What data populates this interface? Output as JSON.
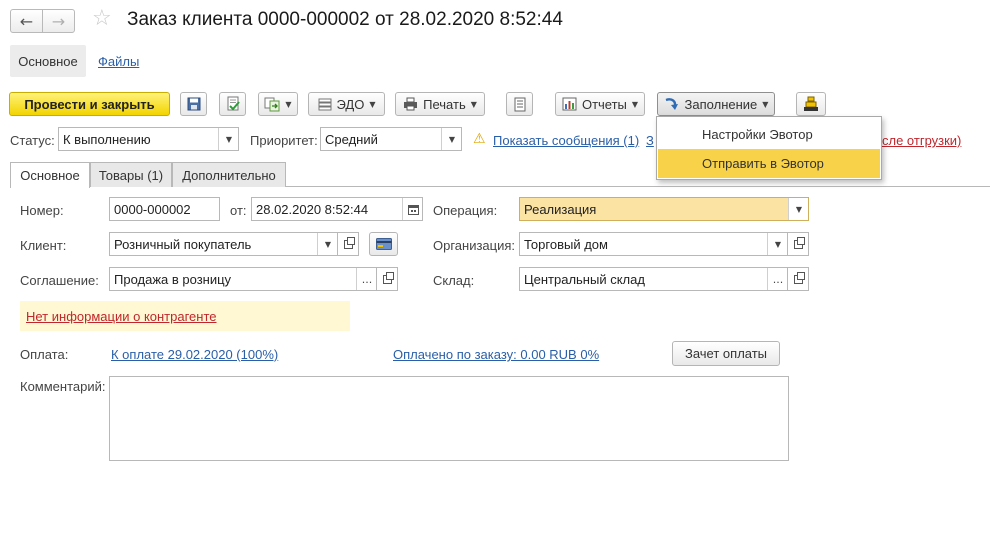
{
  "window": {
    "title": "Заказ клиента 0000-000002 от 28.02.2020 8:52:44"
  },
  "icons": {
    "back": "←",
    "forward": "→",
    "star": "☆",
    "warning": "⚠"
  },
  "sections": {
    "main": "Основное",
    "files": "Файлы"
  },
  "toolbar": {
    "post_close": "Провести и закрыть",
    "edo": "ЭДО",
    "print": "Печать",
    "reports": "Отчеты",
    "fill": "Заполнение"
  },
  "fill_menu": {
    "items": [
      "Настройки Эвотор",
      "Отправить в Эвотор"
    ],
    "selected_index": 1
  },
  "status_row": {
    "status_label": "Статус:",
    "status_value": "К выполнению",
    "priority_label": "Приоритет:",
    "priority_value": "Средний",
    "messages_link": "Показать сообщения (1)",
    "partial_link_left": "З",
    "partial_link_right": "сле отгрузки)"
  },
  "tabs": [
    "Основное",
    "Товары (1)",
    "Дополнительно"
  ],
  "form": {
    "number_label": "Номер:",
    "number_value": "0000-000002",
    "date_label": "от:",
    "date_value": "28.02.2020  8:52:44",
    "operation_label": "Операция:",
    "operation_value": "Реализация",
    "client_label": "Клиент:",
    "client_value": "Розничный покупатель",
    "org_label": "Организация:",
    "org_value": "Торговый дом",
    "agreement_label": "Соглашение:",
    "agreement_value": "Продажа в розницу",
    "warehouse_label": "Склад:",
    "warehouse_value": "Центральный склад",
    "no_info_link": "Нет информации о контрагенте",
    "payment_label": "Оплата:",
    "payment_link": "К оплате 29.02.2020 (100%)",
    "paid_link": "Оплачено по заказу: 0.00 RUB 0%",
    "offset_button": "Зачет оплаты",
    "comment_label": "Комментарий:",
    "comment_value": ""
  },
  "colors": {
    "accent_yellow": "#f2d400",
    "link": "#2a5fa8",
    "error_link": "#c0272d",
    "highlight": "#fbe3a4",
    "menu_selected": "#f8d34a"
  }
}
